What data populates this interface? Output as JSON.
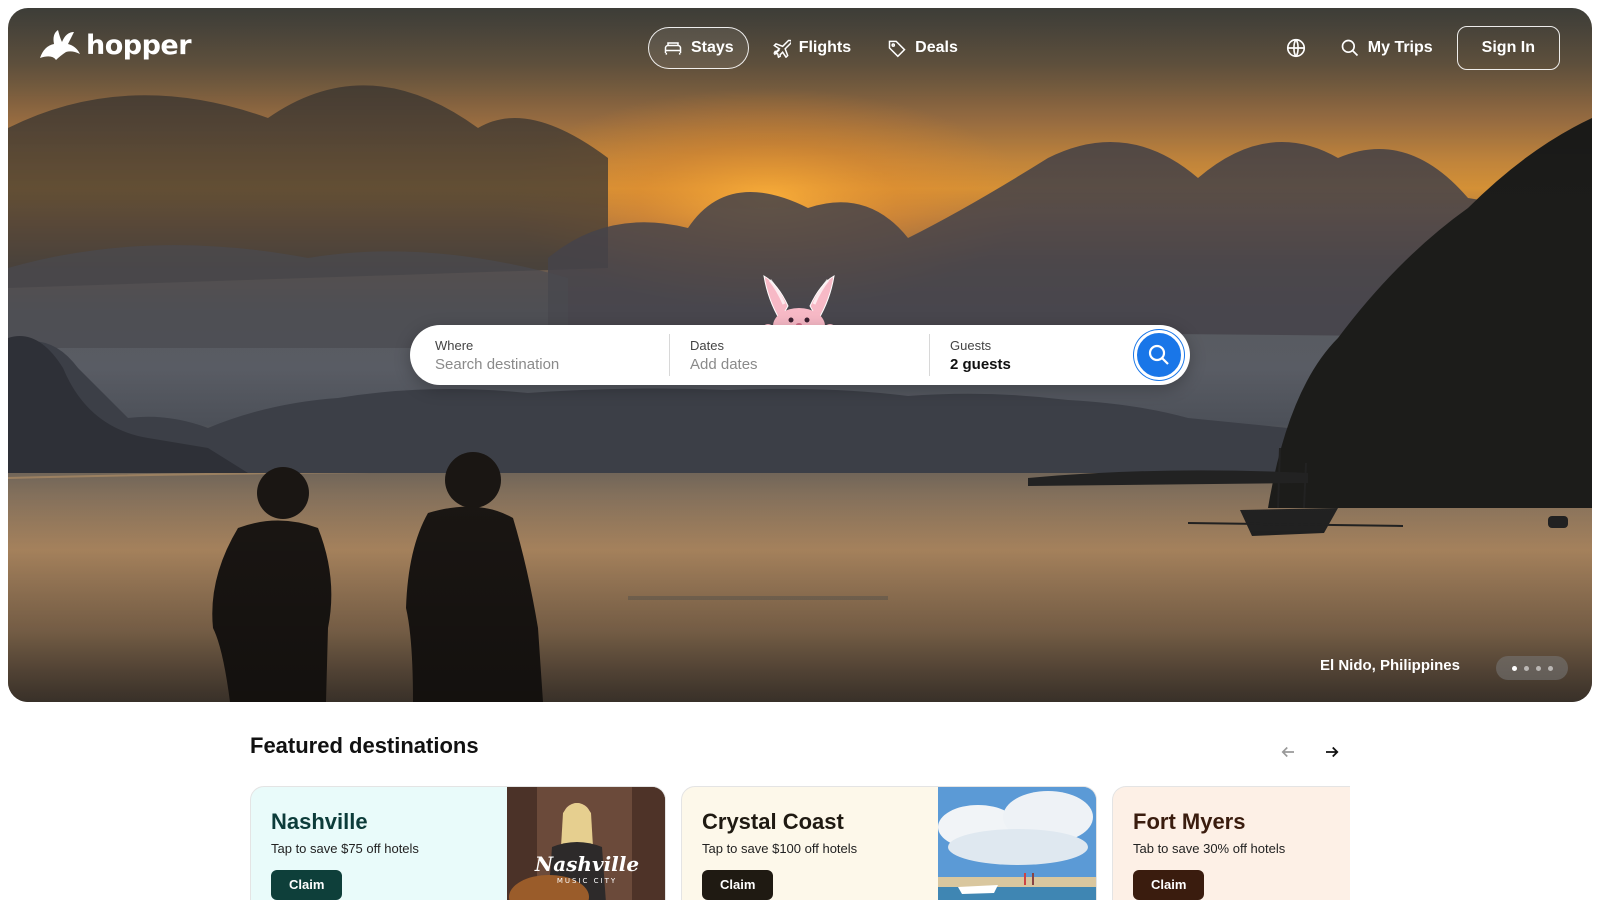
{
  "brand": {
    "name": "hopper"
  },
  "nav": {
    "tabs": [
      {
        "label": "Stays",
        "icon": "bed-icon",
        "active": true
      },
      {
        "label": "Flights",
        "icon": "airplane-icon",
        "active": false
      },
      {
        "label": "Deals",
        "icon": "tag-icon",
        "active": false
      }
    ],
    "my_trips": "My Trips",
    "sign_in": "Sign In"
  },
  "search": {
    "where_label": "Where",
    "where_placeholder": "Search destination",
    "dates_label": "Dates",
    "dates_placeholder": "Add dates",
    "guests_label": "Guests",
    "guests_value": "2 guests"
  },
  "hero": {
    "location": "El Nido, Philippines",
    "slides_total": 4,
    "slide_active": 1
  },
  "featured": {
    "title": "Featured destinations",
    "cards": [
      {
        "name": "Nashville",
        "subtitle": "Tap to save $75 off hotels",
        "cta": "Claim",
        "image_caption": "Nashville",
        "image_subcaption": "MUSIC CITY"
      },
      {
        "name": "Crystal Coast",
        "subtitle": "Tap to save $100 off hotels",
        "cta": "Claim"
      },
      {
        "name": "Fort Myers",
        "subtitle": "Tab to save 30% off hotels",
        "cta": "Claim"
      }
    ]
  },
  "colors": {
    "search_button": "#1976e8",
    "nashville_accent": "#0e3f3a",
    "crystal_coast_accent": "#1f1a12",
    "fort_myers_accent": "#3a1c0e"
  }
}
